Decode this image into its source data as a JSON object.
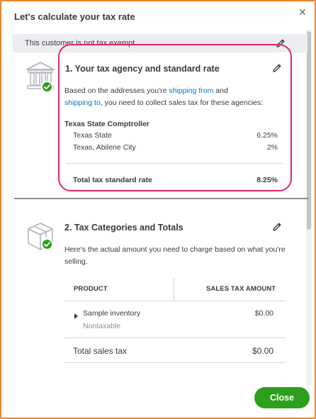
{
  "dialog": {
    "title": "Let's calculate your tax rate",
    "close_icon": "close-icon"
  },
  "exempt": {
    "text": "This customer is not tax exempt",
    "edit_icon": "pencil-icon"
  },
  "agency_section": {
    "icon": "government-building-icon",
    "status_icon": "checkmark-icon",
    "title": "1. Your tax agency and standard rate",
    "desc_prefix": "Based on the addresses you're ",
    "link_shipping_from": "shipping from",
    "desc_and": " and",
    "link_shipping_to": "shipping to",
    "desc_suffix": ", you need to collect sales tax for these agencies:",
    "agency_name": "Texas State Comptroller",
    "rates": [
      {
        "label": "Texas State",
        "value": "6.25%"
      },
      {
        "label": "Texas, Abilene City",
        "value": "2%"
      }
    ],
    "total_label": "Total tax standard rate",
    "total_value": "8.25%"
  },
  "category_section": {
    "icon": "package-box-icon",
    "status_icon": "checkmark-icon",
    "title": "2. Tax Categories and Totals",
    "desc": "Here's the actual amount you need to charge based on what you're selling.",
    "columns": [
      "PRODUCT",
      "SALES TAX AMOUNT"
    ],
    "rows": [
      {
        "product": "Sample inventory",
        "category": "Nontaxable",
        "amount": "$0.00"
      }
    ],
    "total_label": "Total sales tax",
    "total_value": "$0.00"
  },
  "footer": {
    "close_label": "Close"
  },
  "colors": {
    "accent_green": "#2ca01c",
    "link_blue": "#0077c5",
    "highlight_pink": "#e2266a",
    "frame_orange": "#e8852e"
  }
}
